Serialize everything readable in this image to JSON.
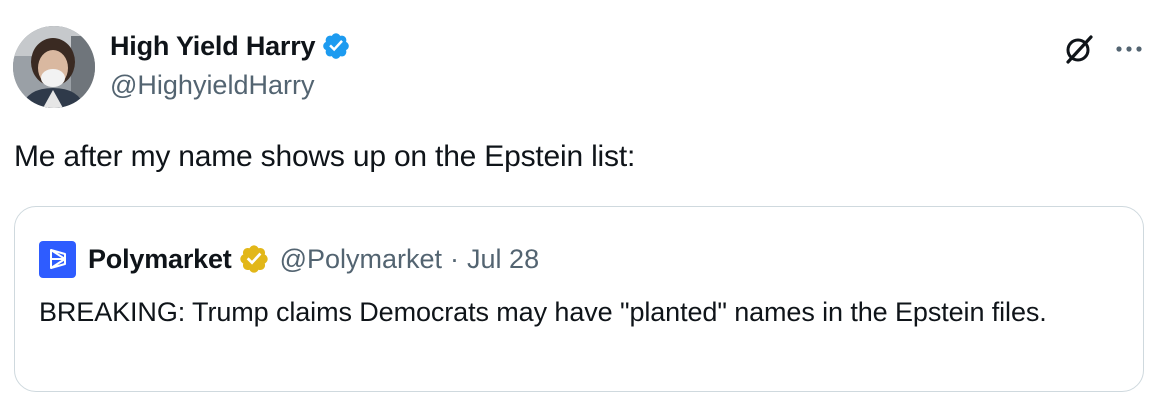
{
  "author": {
    "display_name": "High Yield Harry",
    "handle": "@HighyieldHarry",
    "verified_icon": "blue-verified-badge",
    "avatar_icon": "profile-photo"
  },
  "actions": {
    "grok_icon": "grok-icon",
    "more_icon": "more-options-icon"
  },
  "tweet": {
    "text": "Me after my name shows up on the Epstein list:"
  },
  "quote": {
    "display_name": "Polymarket",
    "handle": "@Polymarket",
    "separator": "·",
    "date": "Jul 28",
    "badge_icon": "gold-verified-badge",
    "logo_icon": "polymarket-logo",
    "text": "BREAKING: Trump claims Democrats may have \"planted\" names in the Epstein files."
  },
  "colors": {
    "accent_blue": "#1d9bf0",
    "gold_badge": "#e2b719",
    "polymarket_blue": "#2e5cff",
    "secondary_text": "#536471",
    "border": "#cfd9de"
  }
}
